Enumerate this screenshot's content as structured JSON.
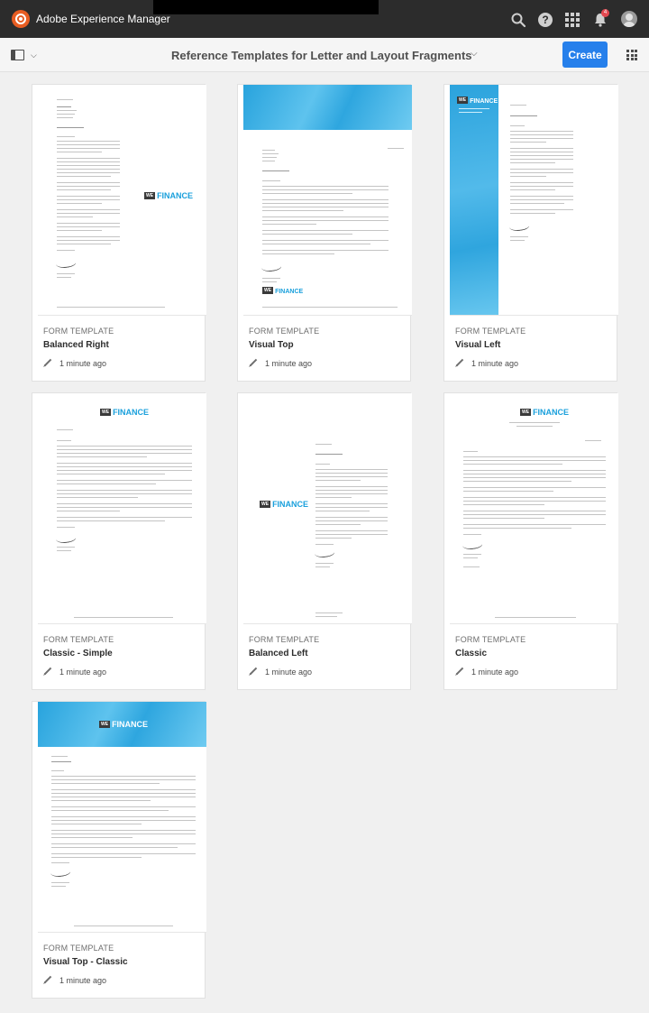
{
  "shell": {
    "app_title": "Adobe Experience Manager",
    "notification_count": "4",
    "help_glyph": "?"
  },
  "actionbar": {
    "title": "Reference Templates for Letter and Layout Fragments",
    "create_label": "Create"
  },
  "icons": {
    "logo": "adobe-experience-manager-icon",
    "search": "search-icon",
    "help": "help-icon",
    "apps": "apps-icon",
    "notifications": "bell-icon",
    "user": "avatar-icon",
    "rail": "rail-toggle-icon",
    "view": "card-view-icon",
    "edited": "pencil-icon"
  },
  "colors": {
    "shell": "#2c2c2c",
    "accent": "#2680eb",
    "finance_blue": "#1aa0dc",
    "badge": "#e34850"
  },
  "thumb_logo": {
    "we": "WE",
    "finance": "FINANCE"
  },
  "cards": [
    {
      "type": "FORM TEMPLATE",
      "title": "Balanced Right",
      "modified": "1 minute ago"
    },
    {
      "type": "FORM TEMPLATE",
      "title": "Visual Top",
      "modified": "1 minute ago"
    },
    {
      "type": "FORM TEMPLATE",
      "title": "Visual Left",
      "modified": "1 minute ago"
    },
    {
      "type": "FORM TEMPLATE",
      "title": "Classic - Simple",
      "modified": "1 minute ago"
    },
    {
      "type": "FORM TEMPLATE",
      "title": "Balanced Left",
      "modified": "1 minute ago"
    },
    {
      "type": "FORM TEMPLATE",
      "title": "Classic",
      "modified": "1 minute ago"
    },
    {
      "type": "FORM TEMPLATE",
      "title": "Visual Top - Classic",
      "modified": "1 minute ago"
    }
  ]
}
